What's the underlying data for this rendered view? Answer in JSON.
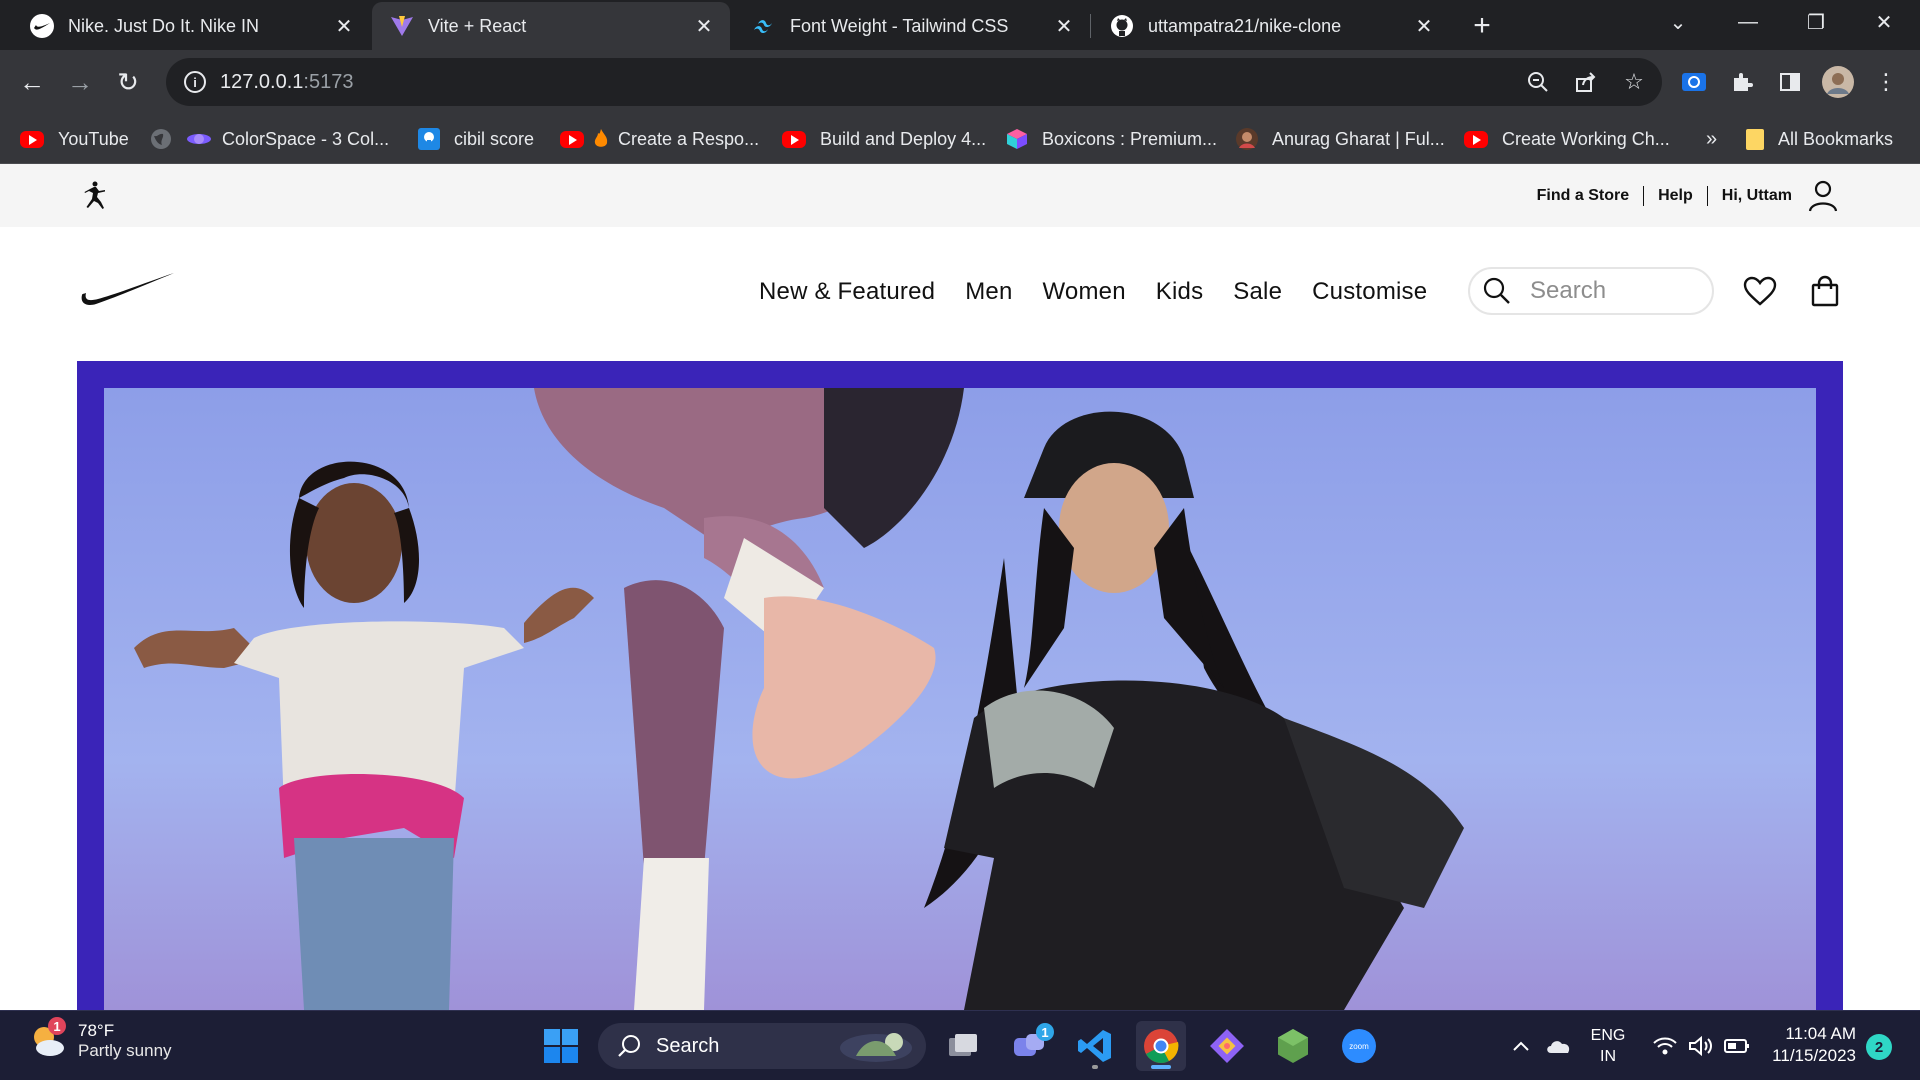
{
  "browser": {
    "tabs": [
      {
        "title": "Nike. Just Do It. Nike IN",
        "favicon": "nike-swoosh-icon"
      },
      {
        "title": "Vite + React",
        "favicon": "vite-icon"
      },
      {
        "title": "Font Weight - Tailwind CSS",
        "favicon": "tailwind-icon"
      },
      {
        "title": "uttampatra21/nike-clone",
        "favicon": "github-icon"
      }
    ],
    "active_tab": 1,
    "address": {
      "host": "127.0.0.1",
      "port": ":5173"
    },
    "bookmarks": [
      {
        "label": "YouTube",
        "icon": "youtube-icon"
      },
      {
        "label": "ColorSpace - 3 Col...",
        "icon": "colorspace-icon"
      },
      {
        "label": "cibil score",
        "icon": "cibil-icon"
      },
      {
        "label": "Create a Respo...",
        "icon": "youtube-fire-icon"
      },
      {
        "label": "Build and Deploy 4...",
        "icon": "youtube-icon"
      },
      {
        "label": "Boxicons : Premium...",
        "icon": "boxicons-icon"
      },
      {
        "label": "Anurag Gharat | Ful...",
        "icon": "avatar-icon"
      },
      {
        "label": "Create Working Ch...",
        "icon": "youtube-icon"
      }
    ],
    "more_bookmarks": "»",
    "all_bookmarks": "All Bookmarks"
  },
  "site": {
    "top_links": [
      "Find a Store",
      "Help",
      "Hi, Uttam"
    ],
    "menu": [
      "New & Featured",
      "Men",
      "Women",
      "Kids",
      "Sale",
      "Customise"
    ],
    "search_placeholder": "Search"
  },
  "taskbar": {
    "weather": {
      "temp": "78°F",
      "condition": "Partly sunny",
      "badge": "1"
    },
    "search_label": "Search",
    "teams_badge": "1",
    "lang_line1": "ENG",
    "lang_line2": "IN",
    "time": "11:04 AM",
    "date": "11/15/2023",
    "notification_count": "2"
  },
  "colors": {
    "hero_border": "#3a24b8",
    "chrome_dark": "#202124",
    "chrome_toolbar": "#35363a",
    "taskbar": "#1c1e35"
  }
}
